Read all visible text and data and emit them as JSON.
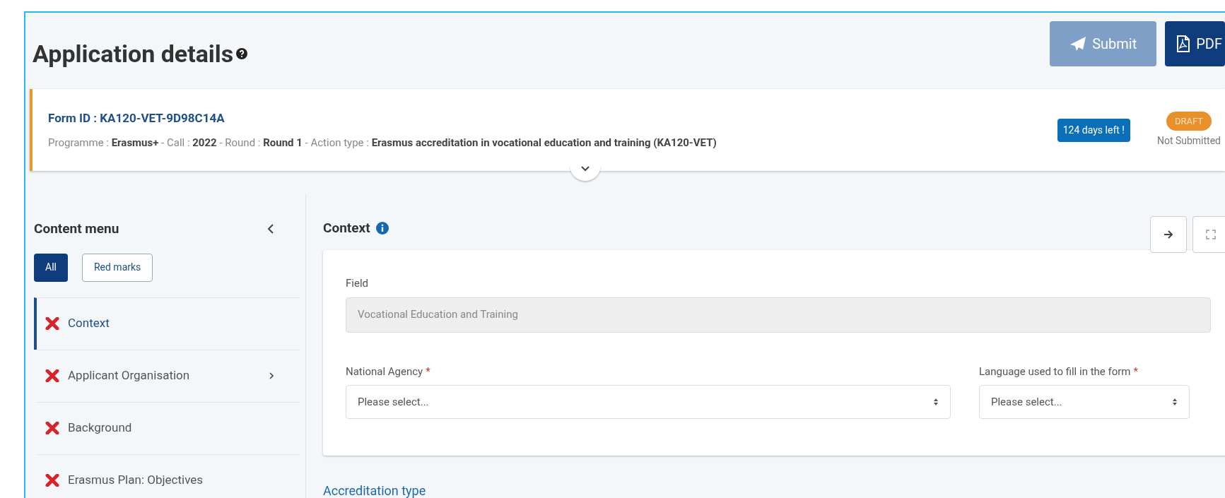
{
  "page": {
    "title": "Application details",
    "actions": [
      {
        "kind": "submit",
        "label": "Submit",
        "disabled": true
      },
      {
        "kind": "pdf",
        "label": "PDF",
        "disabled": false
      }
    ]
  },
  "form_header": {
    "form_id": "Form ID : KA120-VET-9D98C14A",
    "details": "Programme : **Erasmus+** - Call : **2022** - Round : **Round 1** - Action type : **Erasmus accreditation in vocational education and training (KA120-VET)**",
    "deadline": "124 days left !",
    "status_badge": "DRAFT",
    "status": "Not Submitted"
  },
  "content_menu": {
    "title": "Content menu",
    "filters": [
      {
        "label": "All",
        "selected": true
      },
      {
        "label": "Red marks",
        "selected": false
      }
    ],
    "items": [
      {
        "label": "Context",
        "selected": true,
        "has_children": false
      },
      {
        "label": "Applicant Organisation",
        "selected": false,
        "has_children": true
      },
      {
        "label": "Background",
        "selected": false,
        "has_children": false
      },
      {
        "label": "Erasmus Plan: Objectives",
        "selected": false,
        "has_children": false
      }
    ]
  },
  "section": {
    "title": "Context",
    "fields": [
      {
        "kind": "readonly",
        "label": "Field",
        "value": "Vocational Education and Training"
      },
      {
        "kind": "select",
        "label": "National Agency",
        "placeholder": "Please select...",
        "required_mark": "*"
      },
      {
        "kind": "select",
        "label": "Language used to fill in the form",
        "placeholder": "Please select...",
        "required_mark": "*"
      }
    ],
    "next_heading": "Accreditation type"
  }
}
